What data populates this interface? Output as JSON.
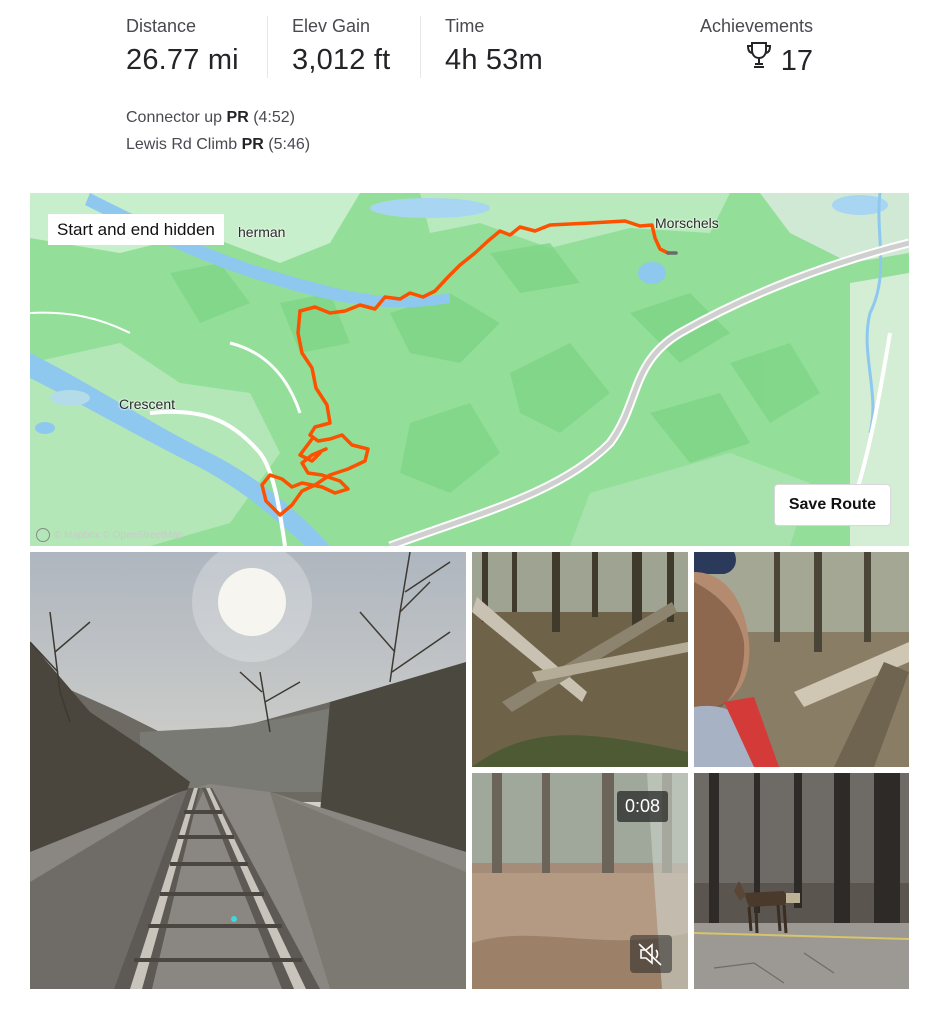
{
  "stats": {
    "distance": {
      "label": "Distance",
      "value": "26.77 mi"
    },
    "elev_gain": {
      "label": "Elev Gain",
      "value": "3,012 ft"
    },
    "time": {
      "label": "Time",
      "value": "4h 53m"
    },
    "achievements": {
      "label": "Achievements",
      "value": "17",
      "icon": "trophy-icon"
    }
  },
  "segments": [
    {
      "name": "Connector up",
      "badge": "PR",
      "time": "(4:52)"
    },
    {
      "name": "Lewis Rd Climb",
      "badge": "PR",
      "time": "(5:46)"
    }
  ],
  "map": {
    "privacy_label": "Start and end hidden",
    "save_button": "Save Route",
    "place_labels": {
      "sherman": "herman",
      "morschels": "Morschels",
      "crescent": "Crescent"
    },
    "attribution": "© Mapbox © OpenStreetMap",
    "route_color": "#fc5200",
    "hidden_route_color": "#6b6b6b"
  },
  "media": {
    "video_duration": "0:08",
    "mute_icon": "muted-speaker-icon"
  }
}
